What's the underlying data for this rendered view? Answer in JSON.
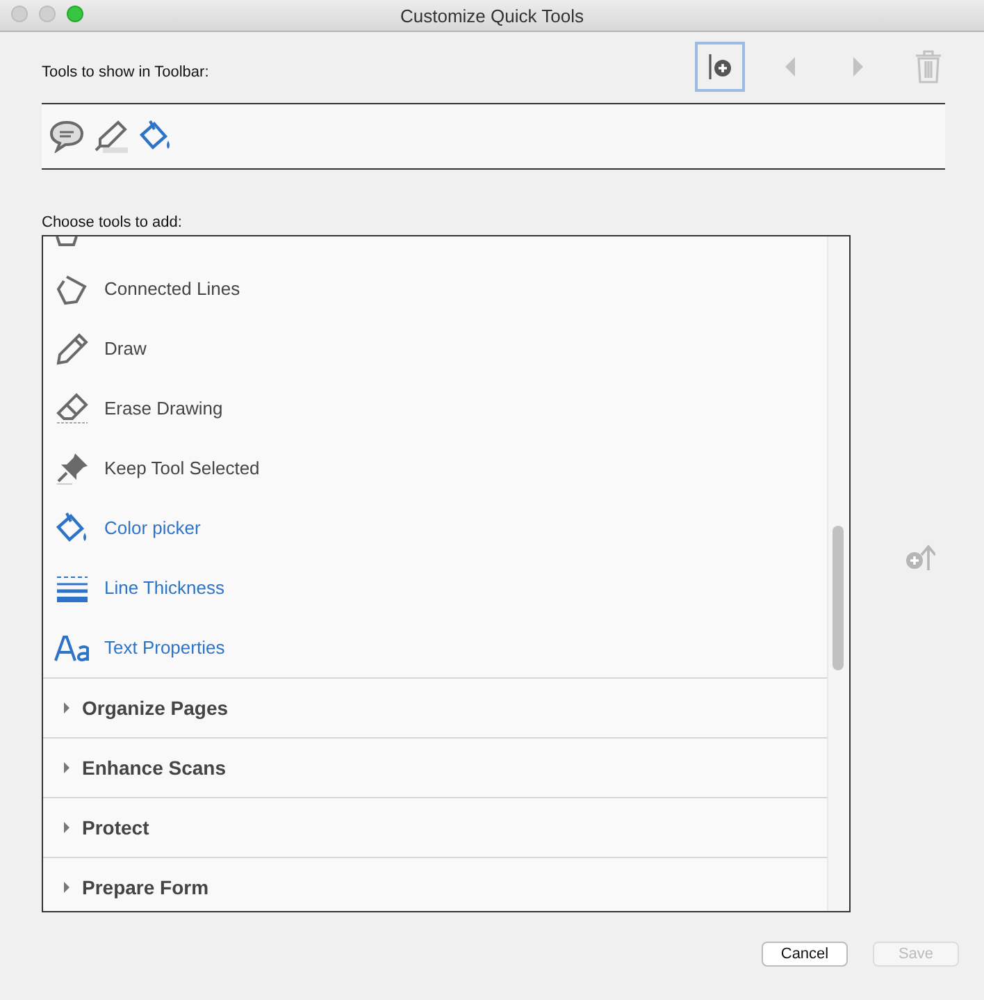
{
  "window": {
    "title": "Customize Quick Tools"
  },
  "toolbar_buttons": [
    {
      "kind": "insert",
      "disabled": false,
      "selected": true
    },
    {
      "kind": "left",
      "disabled": true,
      "selected": false
    },
    {
      "kind": "right",
      "disabled": true,
      "selected": false
    },
    {
      "kind": "delete",
      "disabled": true,
      "selected": false
    }
  ],
  "quick_tools": {
    "label": "Tools to show in Toolbar:",
    "items": [
      {
        "kind": "comment",
        "highlighted": false
      },
      {
        "kind": "highlight",
        "highlighted": false
      },
      {
        "kind": "bucket",
        "highlighted": true
      }
    ]
  },
  "tools_list": {
    "label": "Choose tools to add:",
    "items": [
      {
        "kind": "connected",
        "label": "Connected Lines",
        "highlighted": false
      },
      {
        "kind": "pencil",
        "label": "Draw",
        "highlighted": false
      },
      {
        "kind": "eraser",
        "label": "Erase Drawing",
        "highlighted": false
      },
      {
        "kind": "pin",
        "label": "Keep Tool Selected",
        "highlighted": false
      },
      {
        "kind": "bucket",
        "label": "Color picker",
        "highlighted": true
      },
      {
        "kind": "lines",
        "label": "Line Thickness",
        "highlighted": true
      },
      {
        "kind": "text",
        "label": "Text Properties",
        "highlighted": true
      }
    ],
    "sections": [
      {
        "label": "Organize Pages",
        "expanded": false
      },
      {
        "label": "Enhance Scans",
        "expanded": false
      },
      {
        "label": "Protect",
        "expanded": false
      },
      {
        "label": "Prepare Form",
        "expanded": false
      }
    ]
  },
  "add_button": {
    "disabled": true
  },
  "buttons": [
    {
      "label": "Cancel",
      "disabled": false
    },
    {
      "label": "Save",
      "disabled": true
    }
  ]
}
